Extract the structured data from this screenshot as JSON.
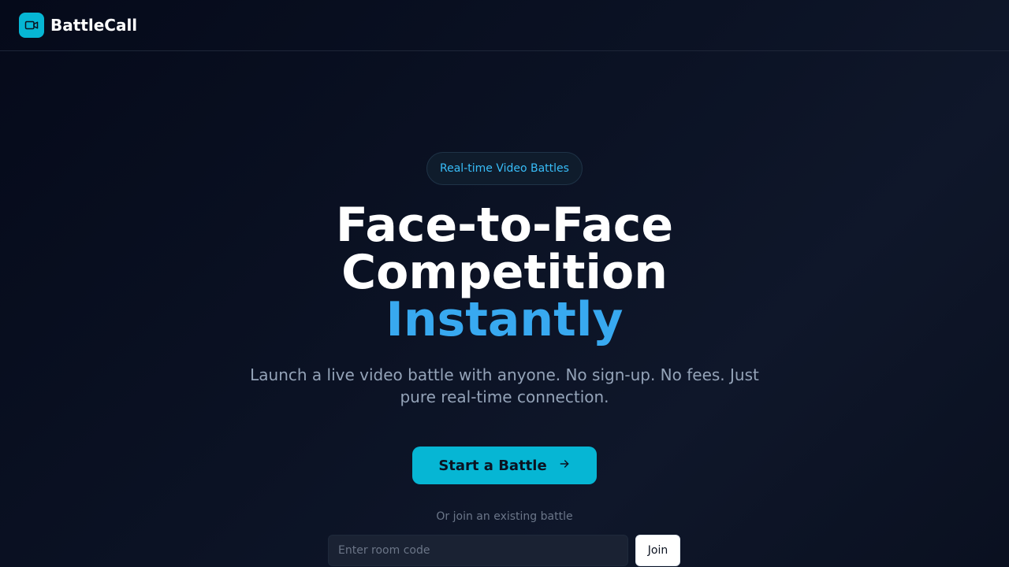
{
  "brand": {
    "name": "BattleCall",
    "logo_icon": "video-camera-icon",
    "accent_color": "#06b6d4"
  },
  "hero": {
    "badge": "Real-time Video Battles",
    "headline_line1": "Face-to-Face",
    "headline_line2": "Competition",
    "headline_accent": "Instantly",
    "subtitle": "Launch a live video battle with anyone. No sign-up. No fees. Just pure real-time connection.",
    "cta_label": "Start a Battle",
    "cta_icon": "arrow-right-icon"
  },
  "join": {
    "hint": "Or join an existing battle",
    "placeholder": "Enter room code",
    "value": "",
    "button_label": "Join"
  }
}
